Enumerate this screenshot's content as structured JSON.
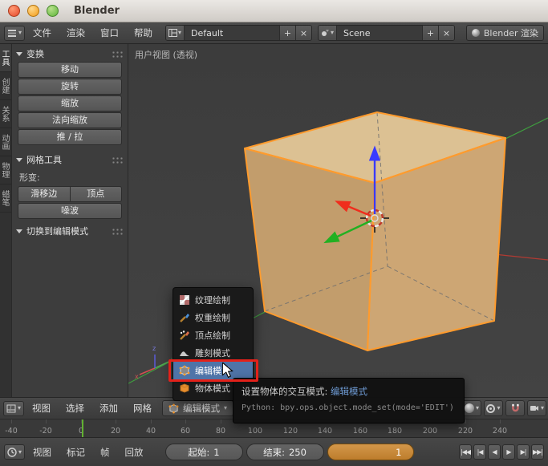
{
  "titlebar": {
    "title": "Blender"
  },
  "icons": {
    "dropdown_arrow": "▾",
    "add": "+",
    "unlink": "×"
  },
  "topbar": {
    "menus": [
      "文件",
      "渲染",
      "窗口",
      "帮助"
    ],
    "layout_value": "Default",
    "scene_value": "Scene",
    "engine_value": "Blender 渲染"
  },
  "toolshelf": {
    "tabs": [
      "工具",
      "创建",
      "关系",
      "动画",
      "物理",
      "蜡笔"
    ],
    "transform_panel": {
      "title": "变换",
      "buttons": [
        "移动",
        "旋转",
        "缩放",
        "法向缩放",
        "推 / 拉"
      ]
    },
    "meshtools_panel": {
      "title": "网格工具",
      "deform_label": "形变:",
      "row_buttons": [
        "滑移边",
        "顶点"
      ],
      "noise_button": "噪波"
    },
    "editmode_panel": {
      "title": "切换到编辑模式"
    }
  },
  "viewport": {
    "view_label": "用户视图 (透视)"
  },
  "mode_menu": {
    "items": [
      {
        "label": "纹理绘制",
        "icon": "texture-paint-icon"
      },
      {
        "label": "权重绘制",
        "icon": "weight-paint-icon"
      },
      {
        "label": "顶点绘制",
        "icon": "vertex-paint-icon"
      },
      {
        "label": "雕刻模式",
        "icon": "sculpt-mode-icon"
      },
      {
        "label": "编辑模式",
        "icon": "edit-mode-icon",
        "selected": true
      },
      {
        "label": "物体模式",
        "icon": "object-mode-icon"
      }
    ]
  },
  "tooltip": {
    "label": "设置物体的交互模式: ",
    "value": "编辑模式",
    "python": "Python: bpy.ops.object.mode_set(mode='EDIT')"
  },
  "view3d_header": {
    "menus": [
      "视图",
      "选择",
      "添加",
      "网格"
    ],
    "mode_button_label": "编辑模式"
  },
  "timeline": {
    "ruler_ticks": [
      "-40",
      "-20",
      "0",
      "20",
      "40",
      "60",
      "80",
      "100",
      "120",
      "140",
      "160",
      "180",
      "200",
      "220",
      "240"
    ],
    "menus": [
      "视图",
      "标记",
      "帧",
      "回放"
    ],
    "start_label": "起始:",
    "start_value": "1",
    "end_label": "结束:",
    "end_value": "250",
    "current_frame": "1",
    "playback": [
      "|◀◀",
      "|◀",
      "◀",
      "▶",
      "▶|",
      "▶▶|"
    ]
  },
  "colors": {
    "selection_outline": "#ff9b2d",
    "menu_highlight": "#4f74a8",
    "annotation": "#e3211a",
    "playhead": "#62b132",
    "frame_field": "#c98a3d"
  }
}
